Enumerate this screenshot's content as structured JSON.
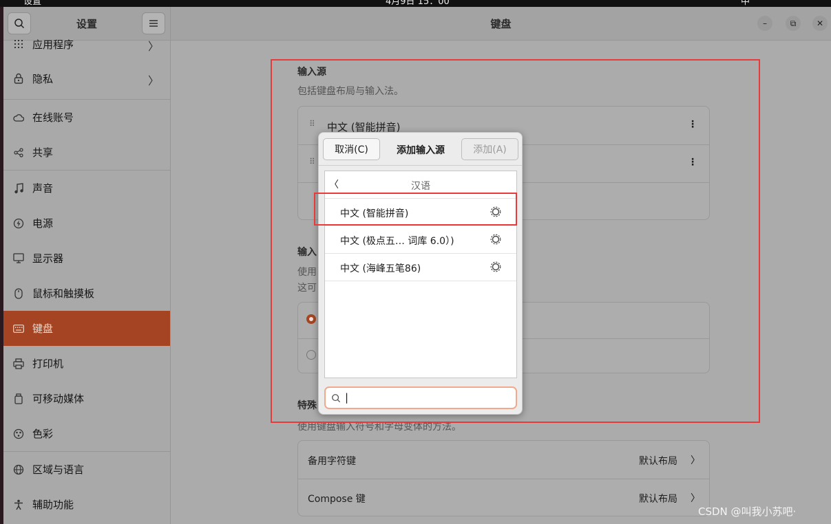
{
  "topbar": {
    "app": "设置",
    "clock": "4月9日 15：00",
    "input_indicator": "中"
  },
  "sidebar": {
    "title": "设置",
    "items": [
      {
        "label": "应用程序",
        "icon": "apps-grid-icon",
        "chevron": "〉"
      },
      {
        "label": "隐私",
        "icon": "lock-icon",
        "chevron": "〉"
      },
      {
        "label": "在线账号",
        "icon": "cloud-icon"
      },
      {
        "label": "共享",
        "icon": "share-icon"
      },
      {
        "label": "声音",
        "icon": "music-note-icon"
      },
      {
        "label": "电源",
        "icon": "power-icon"
      },
      {
        "label": "显示器",
        "icon": "display-icon"
      },
      {
        "label": "鼠标和触摸板",
        "icon": "mouse-icon"
      },
      {
        "label": "键盘",
        "icon": "keyboard-icon"
      },
      {
        "label": "打印机",
        "icon": "printer-icon"
      },
      {
        "label": "可移动媒体",
        "icon": "removable-media-icon"
      },
      {
        "label": "色彩",
        "icon": "color-palette-icon"
      },
      {
        "label": "区域与语言",
        "icon": "globe-icon"
      },
      {
        "label": "辅助功能",
        "icon": "accessibility-icon"
      }
    ]
  },
  "main": {
    "title": "键盘",
    "input_sources": {
      "heading": "输入源",
      "description": "包括键盘布局与输入法。",
      "first_source": "中文 (智能拼音)"
    },
    "switch_section": {
      "heading": "输入",
      "desc1": "使用",
      "desc2": "这可"
    },
    "special_section": {
      "heading": "特殊",
      "description": "使用键盘输入符号和字母变体的方法。"
    },
    "options": [
      {
        "label": "备用字符键",
        "value": "默认布局",
        "chevron": "〉"
      },
      {
        "label": "Compose 键",
        "value": "默认布局",
        "chevron": "〉"
      }
    ]
  },
  "dialog": {
    "cancel": "取消(C)",
    "title": "添加输入源",
    "add": "添加(A)",
    "back": "〈",
    "category": "汉语",
    "items": [
      {
        "label": "中文 (智能拼音)"
      },
      {
        "label": "中文 (极点五… 词库 6.0）)"
      },
      {
        "label": "中文 (海峰五笔86)"
      }
    ],
    "search_value": "|"
  },
  "watermark": "CSDN @叫我小苏吧·",
  "colors": {
    "accent": "#a54423",
    "highlight": "#e8393b",
    "search_focus": "#f0a98c"
  }
}
